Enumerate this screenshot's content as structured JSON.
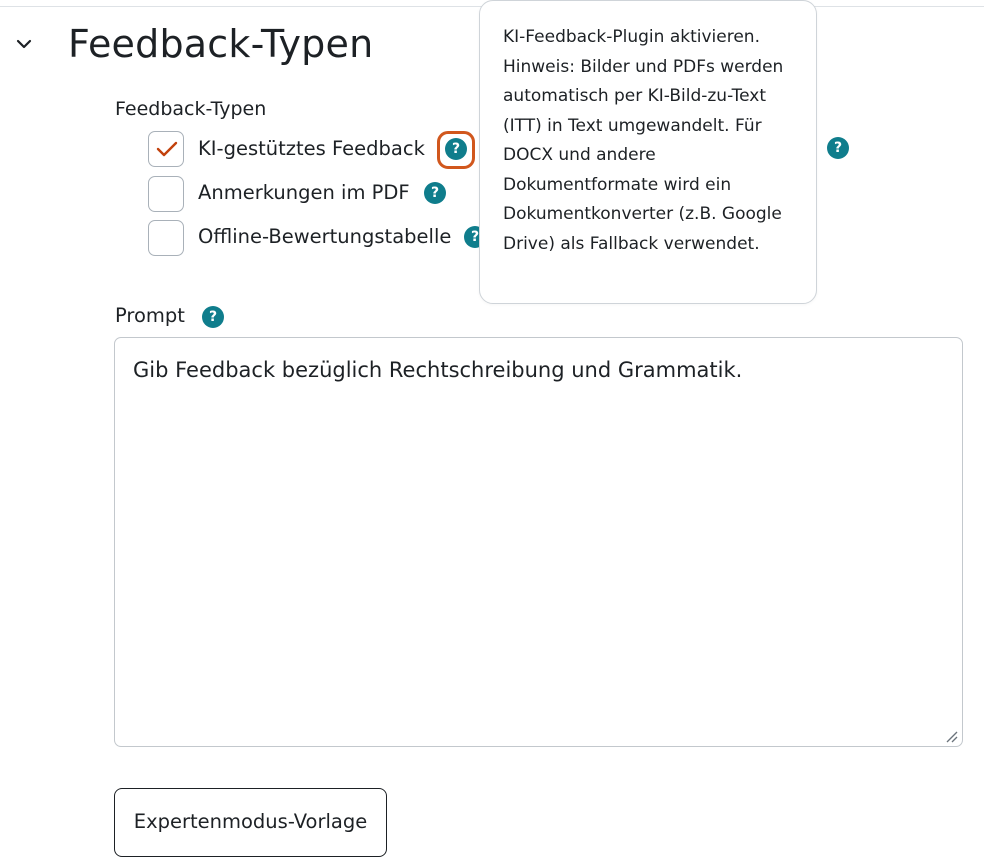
{
  "section": {
    "title": "Feedback-Typen",
    "icon": "chevron-down-icon"
  },
  "feedback_types": {
    "label": "Feedback-Typen",
    "options": [
      {
        "label": "KI-gestütztes Feedback",
        "checked": true
      },
      {
        "label": "Anmerkungen im PDF",
        "checked": false
      },
      {
        "label": "Offline-Bewertungstabelle",
        "checked": false
      }
    ]
  },
  "help": {
    "glyph": "?",
    "icon": "question-circle-icon",
    "color": "#0f7d8c"
  },
  "popover": {
    "lines": [
      "KI-Feedback-Plugin aktivieren.",
      "Hinweis: Bilder und PDFs werden",
      "automatisch per KI-Bild-zu-Text",
      "(ITT) in Text umgewandelt. Für",
      "DOCX und andere",
      "Dokumentformate wird ein",
      "Dokumentkonverter (z.B. Google",
      "Drive) als Fallback verwendet."
    ]
  },
  "prompt": {
    "label": "Prompt",
    "value": "Gib Feedback bezüglich Rechtschreibung und Grammatik."
  },
  "buttons": {
    "preset": "Expertenmodus-Vorlage"
  },
  "colors": {
    "accent": "#0f7d8c",
    "check": "#c2410c",
    "focus": "#d1571d",
    "text": "#1d2125"
  }
}
